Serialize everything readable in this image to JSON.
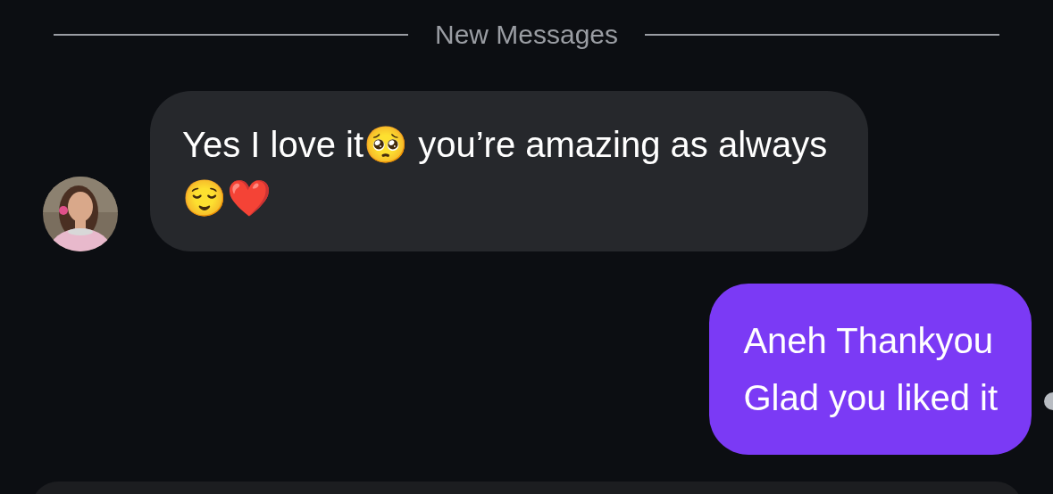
{
  "divider": {
    "label": "New Messages"
  },
  "messages": [
    {
      "kind": "incoming",
      "text": "Yes I love it🥺  you’re amazing as always 😌❤️"
    },
    {
      "kind": "outgoing",
      "text": "Aneh Thankyou\nGlad you liked it"
    }
  ]
}
